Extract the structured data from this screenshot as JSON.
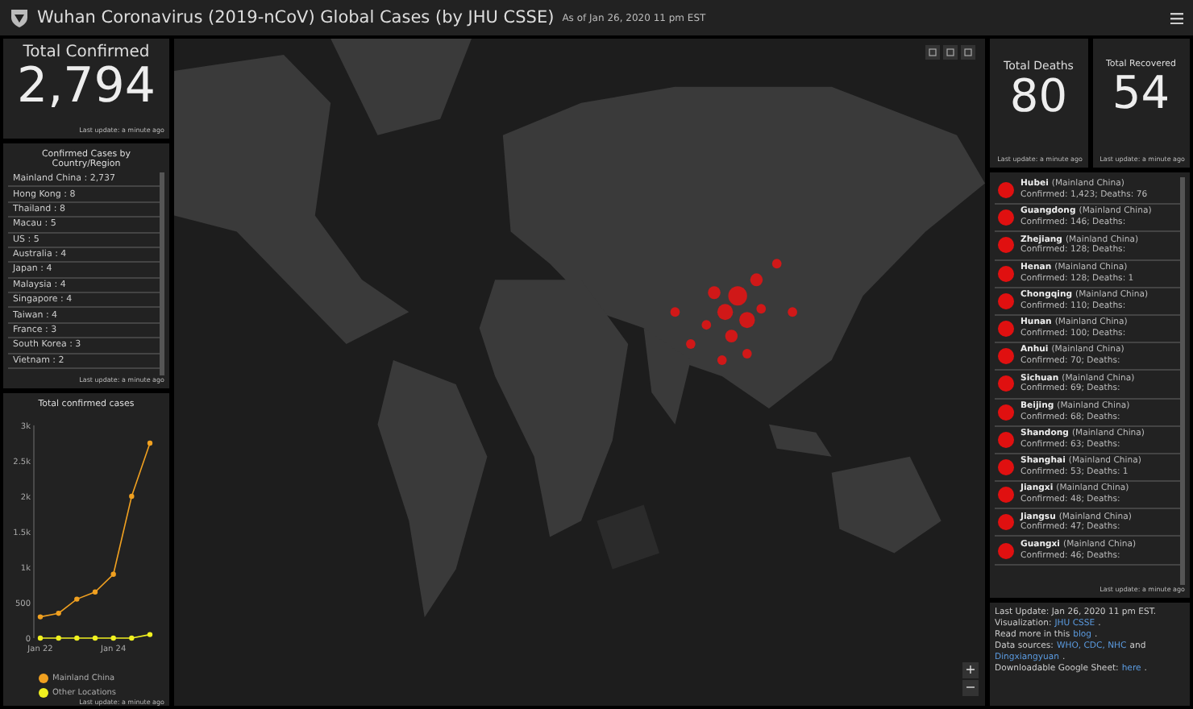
{
  "header": {
    "title": "Wuhan Coronavirus (2019-nCoV) Global Cases (by JHU CSSE)",
    "subtitle": "As of Jan 26, 2020 11 pm EST"
  },
  "total_confirmed": {
    "label": "Total Confirmed",
    "value": "2,794",
    "note": "Last update: a minute ago"
  },
  "country_list": {
    "title": "Confirmed Cases by Country/Region",
    "note": "Last update: a minute ago",
    "rows": [
      {
        "label": "Mainland China : 2,737"
      },
      {
        "label": "Hong Kong : 8"
      },
      {
        "label": "Thailand : 8"
      },
      {
        "label": "Macau : 5"
      },
      {
        "label": "US : 5"
      },
      {
        "label": "Australia : 4"
      },
      {
        "label": "Japan : 4"
      },
      {
        "label": "Malaysia : 4"
      },
      {
        "label": "Singapore : 4"
      },
      {
        "label": "Taiwan : 4"
      },
      {
        "label": "France : 3"
      },
      {
        "label": "South Korea : 3"
      },
      {
        "label": "Vietnam : 2"
      }
    ]
  },
  "chart": {
    "note": "Last update: a minute ago",
    "chart_data": {
      "type": "line",
      "title": "Total confirmed cases",
      "categories": [
        "Jan 22",
        null,
        null,
        null,
        "Jan 24",
        null,
        null
      ],
      "legend": true,
      "ylim": [
        0,
        3000
      ],
      "yticks": [
        {
          "value": 0,
          "label": "0"
        },
        {
          "value": 500,
          "label": "500"
        },
        {
          "value": 1000,
          "label": "1k"
        },
        {
          "value": 1500,
          "label": "1.5k"
        },
        {
          "value": 2000,
          "label": "2k"
        },
        {
          "value": 2500,
          "label": "2.5k"
        },
        {
          "value": 3000,
          "label": "3k"
        }
      ],
      "series": [
        {
          "name": "Mainland China",
          "color": "#f0a020",
          "marker": "circle",
          "values": [
            300,
            350,
            550,
            650,
            900,
            2000,
            2750
          ]
        },
        {
          "name": "Other Locations",
          "color": "#f0f020",
          "marker": "circle",
          "values": [
            0,
            0,
            0,
            0,
            0,
            0,
            50
          ]
        }
      ]
    }
  },
  "deaths": {
    "label": "Total Deaths",
    "value": "80",
    "note": "Last update: a minute ago"
  },
  "recovered": {
    "label": "Total Recovered",
    "value": "54",
    "note": "Last update: a minute ago"
  },
  "province_list": {
    "note": "Last update: a minute ago",
    "rows": [
      {
        "name": "Hubei",
        "region": "(Mainland China)",
        "detail": "Confirmed: 1,423; Deaths: 76"
      },
      {
        "name": "Guangdong",
        "region": "(Mainland China)",
        "detail": "Confirmed: 146; Deaths:"
      },
      {
        "name": "Zhejiang",
        "region": "(Mainland China)",
        "detail": "Confirmed: 128; Deaths:"
      },
      {
        "name": "Henan",
        "region": "(Mainland China)",
        "detail": "Confirmed: 128; Deaths: 1"
      },
      {
        "name": "Chongqing",
        "region": "(Mainland China)",
        "detail": "Confirmed: 110; Deaths:"
      },
      {
        "name": "Hunan",
        "region": "(Mainland China)",
        "detail": "Confirmed: 100; Deaths:"
      },
      {
        "name": "Anhui",
        "region": "(Mainland China)",
        "detail": "Confirmed: 70; Deaths:"
      },
      {
        "name": "Sichuan",
        "region": "(Mainland China)",
        "detail": "Confirmed: 69; Deaths:"
      },
      {
        "name": "Beijing",
        "region": "(Mainland China)",
        "detail": "Confirmed: 68; Deaths:"
      },
      {
        "name": "Shandong",
        "region": "(Mainland China)",
        "detail": "Confirmed: 63; Deaths:"
      },
      {
        "name": "Shanghai",
        "region": "(Mainland China)",
        "detail": "Confirmed: 53; Deaths: 1"
      },
      {
        "name": "Jiangxi",
        "region": "(Mainland China)",
        "detail": "Confirmed: 48; Deaths:"
      },
      {
        "name": "Jiangsu",
        "region": "(Mainland China)",
        "detail": "Confirmed: 47; Deaths:"
      },
      {
        "name": "Guangxi",
        "region": "(Mainland China)",
        "detail": "Confirmed: 46; Deaths:"
      }
    ]
  },
  "info": {
    "lines": [
      [
        {
          "text": "Last Update: Jan 26, 2020 11 pm EST.",
          "link": false
        }
      ],
      [
        {
          "text": "Visualization:",
          "link": false
        },
        {
          "text": "JHU CSSE",
          "link": true
        },
        {
          "text": ".",
          "link": false
        }
      ],
      [
        {
          "text": "Read more in this",
          "link": false
        },
        {
          "text": "blog",
          "link": true
        },
        {
          "text": ".",
          "link": false
        }
      ],
      [
        {
          "text": "Data sources:",
          "link": false
        },
        {
          "text": "WHO, CDC, NHC",
          "link": true
        },
        {
          "text": "and",
          "link": false
        }
      ],
      [
        {
          "text": "Dingxiangyuan",
          "link": true
        },
        {
          "text": ".",
          "link": false
        }
      ],
      [
        {
          "text": "Downloadable Google Sheet:",
          "link": false
        },
        {
          "text": "here",
          "link": true
        },
        {
          "text": ".",
          "link": false
        }
      ]
    ]
  },
  "map": {
    "zoom_in": "+",
    "zoom_out": "−"
  }
}
